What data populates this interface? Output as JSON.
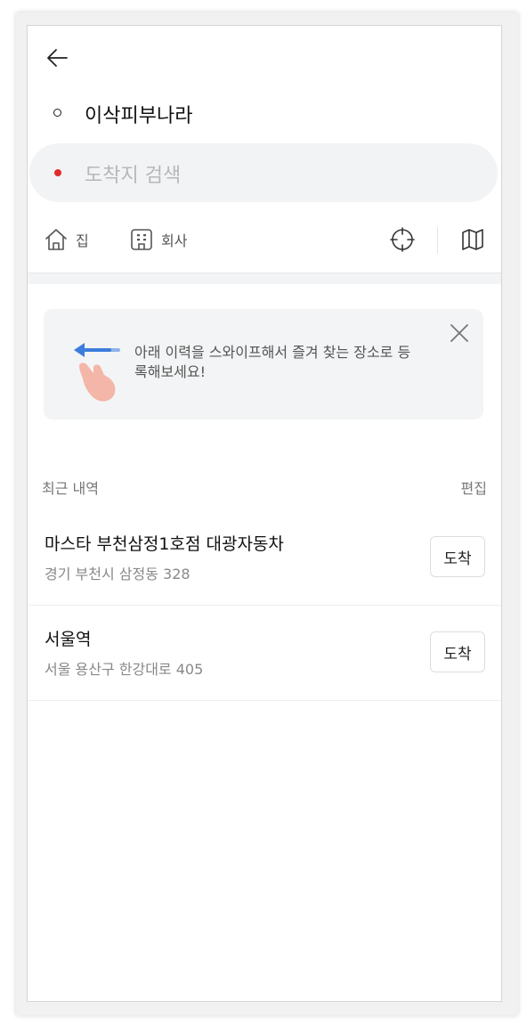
{
  "route": {
    "origin": "이삭피부나라",
    "destination_placeholder": "도착지 검색"
  },
  "shortcuts": {
    "home_label": "집",
    "office_label": "회사"
  },
  "tip": {
    "text": "아래 이력을 스와이프해서 즐겨 찾는 장소로 등록해보세요!"
  },
  "history": {
    "title": "최근 내역",
    "edit_label": "편집",
    "items": [
      {
        "name": "마스타 부천삼정1호점 대광자동차",
        "address": "경기 부천시 삼정동 328",
        "action": "도착"
      },
      {
        "name": "서울역",
        "address": "서울 용산구 한강대로 405",
        "action": "도착"
      }
    ]
  },
  "colors": {
    "destination_dot": "#e02c2c",
    "tip_arrow": "#3b7ddd",
    "hand": "#f3b6a8"
  },
  "icons": {
    "back": "arrow-left-icon",
    "home": "home-icon",
    "office": "building-icon",
    "location": "crosshair-icon",
    "map": "map-icon",
    "close": "close-icon"
  }
}
